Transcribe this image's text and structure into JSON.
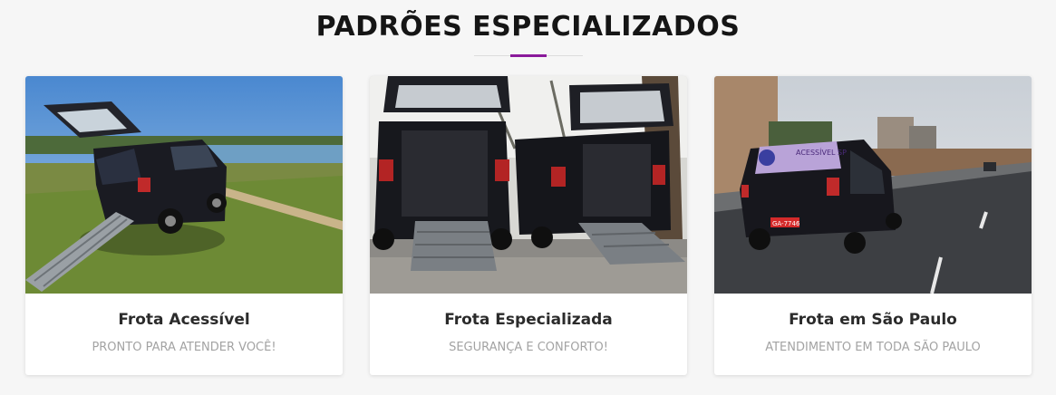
{
  "section": {
    "title": "PADRÕES ESPECIALIZADOS"
  },
  "cards": [
    {
      "title": "Frota Acessível",
      "subtitle": "PRONTO PARA ATENDER VOCÊ!",
      "image": "van-with-ramp-by-lake-photo"
    },
    {
      "title": "Frota Especializada",
      "subtitle": "SEGURANÇA E CONFORTO!",
      "image": "two-vans-with-ramps-photo"
    },
    {
      "title": "Frota em São Paulo",
      "subtitle": "ATENDIMENTO EM TODA SÃO PAULO",
      "image": "van-on-city-road-photo",
      "photo_text": {
        "rear_window": "ACESSÍVEL SP",
        "plate": "GA-7746"
      }
    }
  ],
  "colors": {
    "accent": "#8b1a9b",
    "background": "#f6f6f6",
    "card": "#ffffff",
    "title": "#151515",
    "subtitle": "#a3a3a3"
  }
}
